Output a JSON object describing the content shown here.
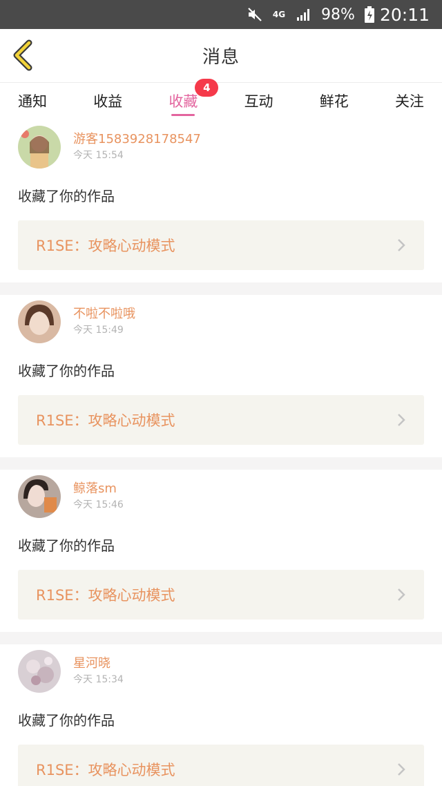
{
  "status_bar": {
    "network": "4G",
    "battery": "98%",
    "time": "20:11"
  },
  "header": {
    "title": "消息"
  },
  "tabs": [
    {
      "label": "通知"
    },
    {
      "label": "收益"
    },
    {
      "label": "收藏",
      "badge": "4"
    },
    {
      "label": "互动"
    },
    {
      "label": "鲜花"
    },
    {
      "label": "关注"
    }
  ],
  "colors": {
    "accent": "#e3649e",
    "name": "#e8935f",
    "badge": "#f5394a",
    "card_bg": "#f5f4ee"
  },
  "items": [
    {
      "user": "游客1583928178547",
      "time": "今天 15:54",
      "action": "收藏了你的作品",
      "work": "R1SE：攻略心动模式"
    },
    {
      "user": "不啦不啦哦",
      "time": "今天 15:49",
      "action": "收藏了你的作品",
      "work": "R1SE：攻略心动模式"
    },
    {
      "user": "鲸落sm",
      "time": "今天 15:46",
      "action": "收藏了你的作品",
      "work": "R1SE：攻略心动模式"
    },
    {
      "user": "星河晓",
      "time": "今天 15:34",
      "action": "收藏了你的作品",
      "work": "R1SE：攻略心动模式"
    }
  ]
}
